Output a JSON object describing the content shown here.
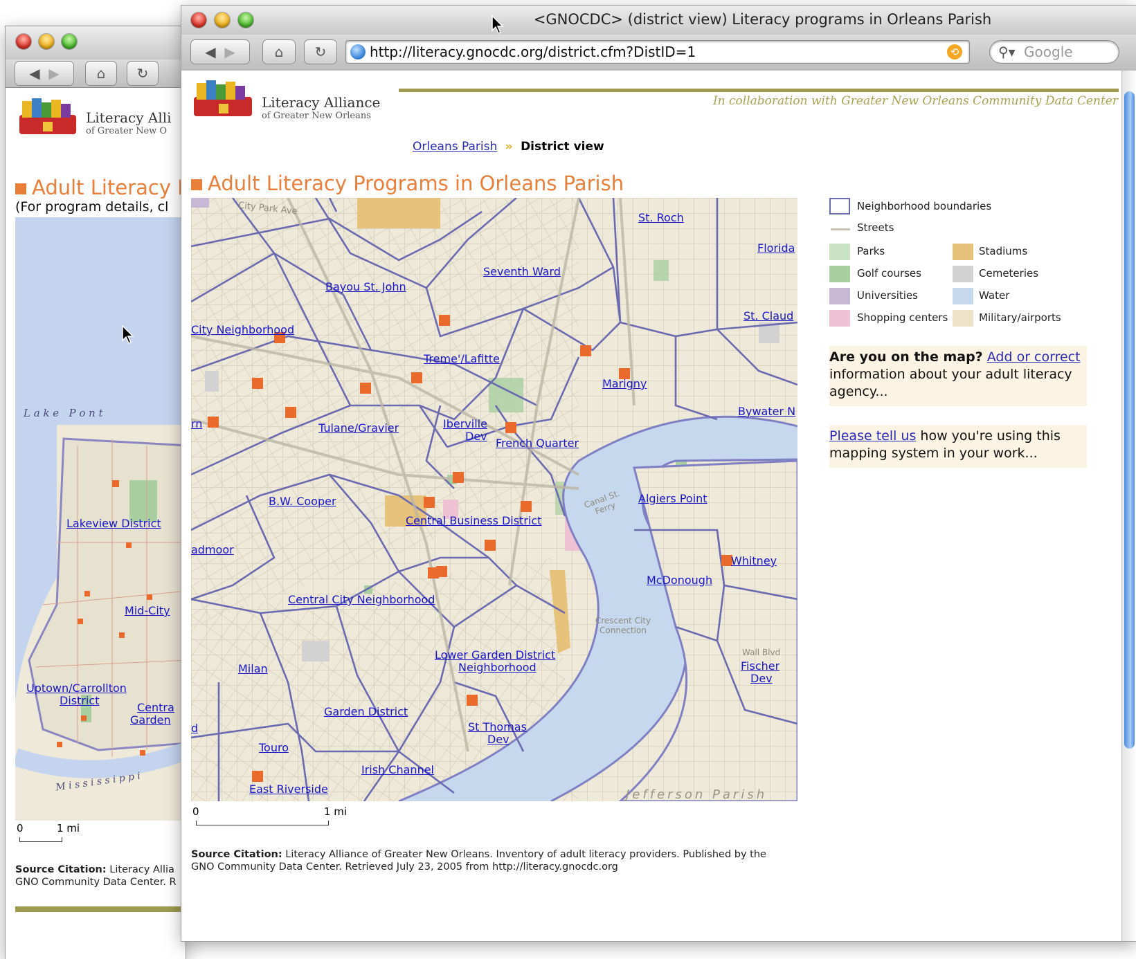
{
  "back_window": {
    "logo_title": "Literacy Alli",
    "logo_subtitle": "of Greater New O",
    "heading": "Adult Literacy P",
    "subheading": "(For program details, cl",
    "lake_label": "L a k e   P o n t",
    "river_label": "M i s s i s s i p p i",
    "district_labels": [
      "Lakeview District",
      "Mid-City",
      "Uptown/Carrollton",
      "District",
      "Centra",
      "Garden"
    ],
    "scale_zero": "0",
    "scale_one": "1 mi",
    "citation_bold": "Source Citation:",
    "citation_line1": "Literacy Allia",
    "citation_line2": "GNO Community Data Center. R"
  },
  "front_window": {
    "window_title": "<GNOCDC> (district view) Literacy programs in Orleans Parish",
    "url": "http://literacy.gnocdc.org/district.cfm?DistID=1",
    "search_placeholder": "Google",
    "logo_title": "Literacy Alliance",
    "logo_subtitle": "of Greater New Orleans",
    "collaboration": "In collaboration with Greater New Orleans Community Data Center",
    "breadcrumb": {
      "link": "Orleans Parish",
      "separator": "»",
      "current": "District view"
    },
    "heading": "Adult Literacy Programs in Orleans Parish",
    "map_street_labels": [
      "City Park Ave",
      "Canal St. Ferry",
      "Crescent City Connection",
      "Jefferson Parish",
      "Wall Blvd"
    ],
    "map_labels": [
      "St. Roch",
      "Florida",
      "Seventh Ward",
      "Bayou St. John",
      "St. Claud",
      "City Neighborhood",
      "Treme'/Lafitte",
      "Marigny",
      "Bywater N",
      "Tulane/Gravier",
      "Iberville",
      "Dev",
      "French Quarter",
      "rn",
      "B.W. Cooper",
      "Algiers Point",
      "Central Business District",
      "admoor",
      "Whitney",
      "McDonough",
      "Central City Neighborhood",
      "Lower Garden District",
      "Neighborhood",
      "Fischer",
      "Dev",
      "Milan",
      "Garden District",
      "St Thomas",
      "Dev",
      "d",
      "Touro",
      "Irish Channel",
      "East Riverside"
    ],
    "scale_zero": "0",
    "scale_one": "1 mi",
    "legend": [
      {
        "label": "Neighborhood boundaries",
        "color": "#6a6ab0"
      },
      {
        "label": "Streets",
        "color": "#c8c4b4"
      },
      {
        "label": "Parks",
        "color": "#c9e2c2"
      },
      {
        "label": "Stadiums",
        "color": "#e7c27b"
      },
      {
        "label": "Golf courses",
        "color": "#a9cfa0"
      },
      {
        "label": "Cemeteries",
        "color": "#d2d2d2"
      },
      {
        "label": "Universities",
        "color": "#c7b8d6"
      },
      {
        "label": "Water",
        "color": "#c6d8ee"
      },
      {
        "label": "Shopping centers",
        "color": "#eec2d2"
      },
      {
        "label": "Military/airports",
        "color": "#ece3c8"
      }
    ],
    "promo1_bold": "Are you on the map?",
    "promo1_link": "Add or correct",
    "promo1_rest": "information about your adult literacy agency...",
    "promo2_link": "Please tell us",
    "promo2_rest": "how you're using this mapping system in your work...",
    "citation_bold": "Source Citation:",
    "citation_line1": "Literacy Alliance of Greater New Orleans. Inventory of adult literacy providers. Published by the",
    "citation_line2": "GNO Community Data Center. Retrieved July 23, 2005 from http://literacy.gnocdc.org"
  }
}
